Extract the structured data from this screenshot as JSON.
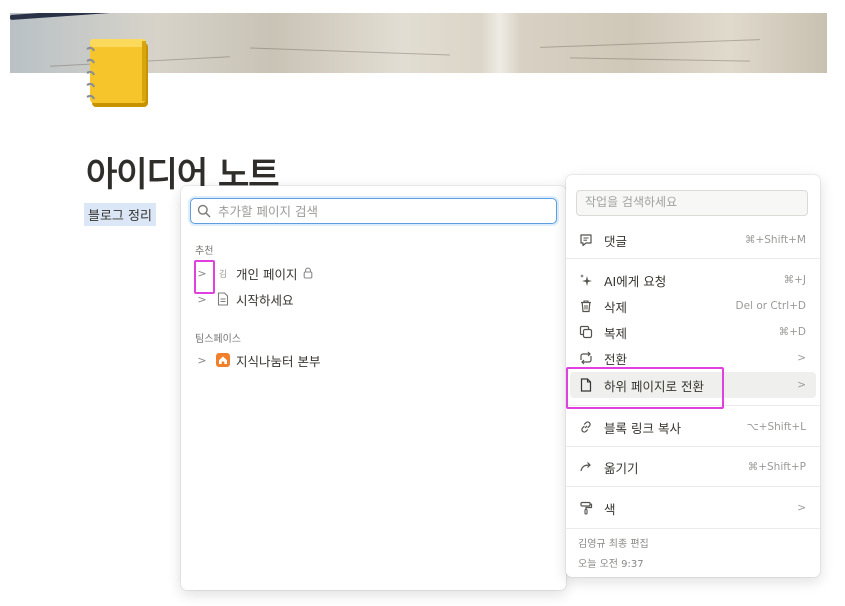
{
  "page": {
    "title": "아이디어 노트",
    "property_label": "블로그 정리"
  },
  "move_panel": {
    "search_placeholder": "추가할 페이지 검색",
    "section_recommended": "추천",
    "section_teamspace": "팀스페이스",
    "items": [
      {
        "icon_text": "김",
        "label": "개인 페이지",
        "icon": "lock-icon"
      },
      {
        "label": "시작하세요",
        "icon": "document-icon"
      },
      {
        "label": "지식나눔터 본부",
        "icon": "house-icon"
      }
    ]
  },
  "action_menu": {
    "search_placeholder": "작업을 검색하세요",
    "items": [
      {
        "label": "댓글",
        "shortcut": "⌘+Shift+M",
        "icon": "comment-icon"
      },
      {
        "label": "AI에게 요청",
        "shortcut": "⌘+J",
        "icon": "ai-sparkle-icon"
      },
      {
        "label": "삭제",
        "shortcut": "Del or Ctrl+D",
        "icon": "trash-icon"
      },
      {
        "label": "복제",
        "shortcut": "⌘+D",
        "icon": "duplicate-icon"
      },
      {
        "label": "전환",
        "shortcut": ">",
        "icon": "turn-into-icon"
      },
      {
        "label": "하위 페이지로 전환",
        "shortcut": ">",
        "icon": "page-icon"
      },
      {
        "label": "블록 링크 복사",
        "shortcut": "⌥+Shift+L",
        "icon": "link-icon"
      },
      {
        "label": "옮기기",
        "shortcut": "⌘+Shift+P",
        "icon": "move-arrow-icon"
      },
      {
        "label": "색",
        "shortcut": ">",
        "icon": "paint-roller-icon"
      }
    ],
    "footer_editor": "김영규 최종 편집",
    "footer_time": "오늘 오전 9:37"
  },
  "colors": {
    "highlight": "#e040e0",
    "search_focus": "#5e9ee0",
    "property_bg": "#dbe7f6",
    "house_icon": "#f0802b"
  }
}
